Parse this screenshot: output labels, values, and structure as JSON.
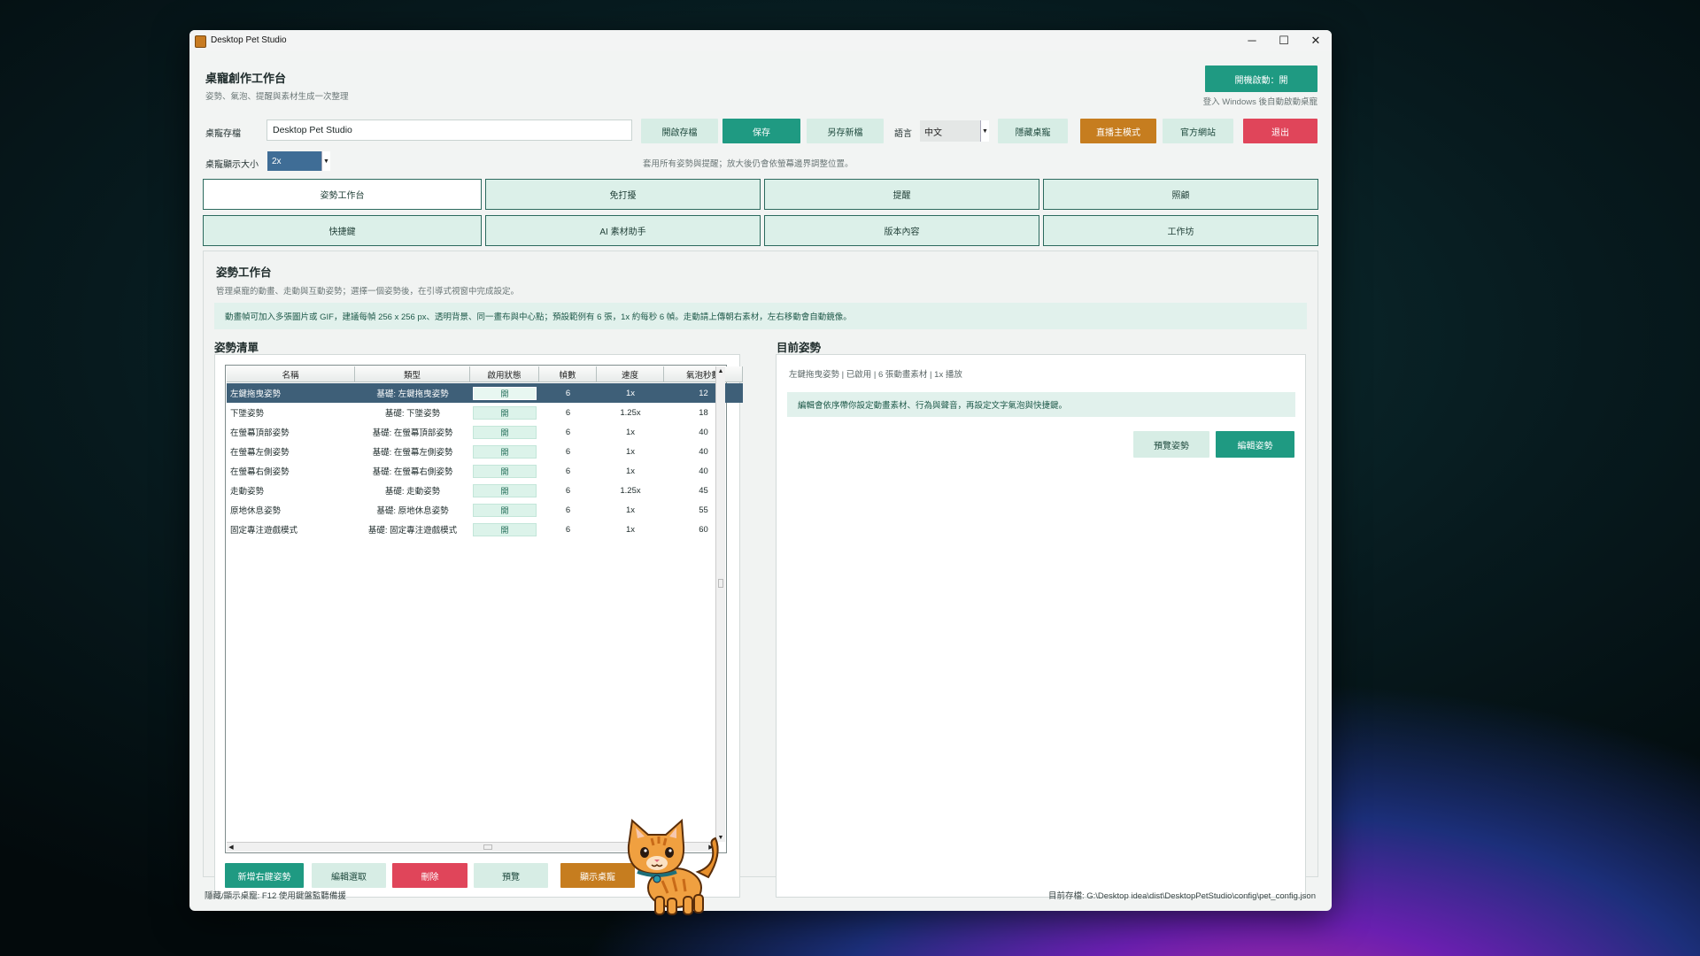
{
  "window": {
    "title": "Desktop Pet Studio",
    "controls": {
      "minimize": "─",
      "maximize": "☐",
      "close": "✕"
    }
  },
  "header": {
    "title": "桌寵創作工作台",
    "subtitle": "姿勢、氣泡、提醒與素材生成一次整理",
    "startup_button": "開機啟動：開",
    "startup_hint": "登入 Windows 後自動啟動桌寵"
  },
  "toolbar": {
    "save_file_label": "桌寵存檔",
    "save_file_value": "Desktop Pet Studio",
    "open_save": "開啟存檔",
    "save": "保存",
    "save_as": "另存新檔",
    "language_label": "語言",
    "language_value": "中文",
    "hide_pet": "隱藏桌寵",
    "streamer_mode": "直播主模式",
    "official_site": "官方網站",
    "exit": "退出"
  },
  "size_row": {
    "label": "桌寵顯示大小",
    "value": "2x",
    "hint": "套用所有姿勢與提醒；放大後仍會依螢幕邊界調整位置。"
  },
  "tabs": [
    {
      "label": "姿勢工作台",
      "active": true
    },
    {
      "label": "免打擾",
      "active": false
    },
    {
      "label": "提醒",
      "active": false
    },
    {
      "label": "照顧",
      "active": false
    },
    {
      "label": "快捷鍵",
      "active": false
    },
    {
      "label": "AI 素材助手",
      "active": false
    },
    {
      "label": "版本內容",
      "active": false
    },
    {
      "label": "工作坊",
      "active": false
    }
  ],
  "workbench": {
    "title": "姿勢工作台",
    "subtitle": "管理桌寵的動畫、走動與互動姿勢；選擇一個姿勢後，在引導式視窗中完成設定。",
    "banner": "動畫幀可加入多張圖片或 GIF，建議每幀 256 x 256 px、透明背景、同一畫布與中心點；預設範例有 6 張，1x 約每秒 6 幀。走動請上傳朝右素材，左右移動會自動鏡像。"
  },
  "pose_list": {
    "title": "姿勢清單",
    "columns": [
      "名稱",
      "類型",
      "啟用狀態",
      "幀數",
      "速度",
      "氣泡秒數"
    ],
    "rows": [
      {
        "name": "左鍵拖曳姿勢",
        "type": "基礎: 左鍵拖曳姿勢",
        "status": "開",
        "frames": "6",
        "speed": "1x",
        "bubble": "12"
      },
      {
        "name": "下墜姿勢",
        "type": "基礎: 下墜姿勢",
        "status": "開",
        "frames": "6",
        "speed": "1.25x",
        "bubble": "18"
      },
      {
        "name": "在螢幕頂部姿勢",
        "type": "基礎: 在螢幕頂部姿勢",
        "status": "開",
        "frames": "6",
        "speed": "1x",
        "bubble": "40"
      },
      {
        "name": "在螢幕左側姿勢",
        "type": "基礎: 在螢幕左側姿勢",
        "status": "開",
        "frames": "6",
        "speed": "1x",
        "bubble": "40"
      },
      {
        "name": "在螢幕右側姿勢",
        "type": "基礎: 在螢幕右側姿勢",
        "status": "開",
        "frames": "6",
        "speed": "1x",
        "bubble": "40"
      },
      {
        "name": "走動姿勢",
        "type": "基礎: 走動姿勢",
        "status": "開",
        "frames": "6",
        "speed": "1.25x",
        "bubble": "45"
      },
      {
        "name": "原地休息姿勢",
        "type": "基礎: 原地休息姿勢",
        "status": "開",
        "frames": "6",
        "speed": "1x",
        "bubble": "55"
      },
      {
        "name": "固定專注遊戲模式",
        "type": "基礎: 固定專注遊戲模式",
        "status": "開",
        "frames": "6",
        "speed": "1x",
        "bubble": "60"
      }
    ],
    "buttons": {
      "add": "新增右鍵姿勢",
      "edit": "編輯選取",
      "delete": "刪除",
      "preview": "預覽",
      "show_pet": "顯示桌寵"
    }
  },
  "current_pose": {
    "title": "目前姿勢",
    "summary": "左鍵拖曳姿勢 | 已啟用 | 6 張動畫素材 | 1x 播放",
    "note": "編輯會依序帶你設定動畫素材、行為與聲音，再設定文字氣泡與快捷鍵。",
    "preview_button": "預覽姿勢",
    "edit_button": "編輯姿勢"
  },
  "footer": {
    "left": "隱藏/顯示桌寵: F12 使用鍵盤監聽備援",
    "right": "目前存檔: G:\\Desktop idea\\dist\\DesktopPetStudio\\config\\pet_config.json"
  },
  "colors": {
    "accent_teal": "#1f9a82",
    "accent_orange": "#c67d1f",
    "accent_red": "#e0455a",
    "light_green": "#d7ede5",
    "selection": "#3e5f78"
  }
}
